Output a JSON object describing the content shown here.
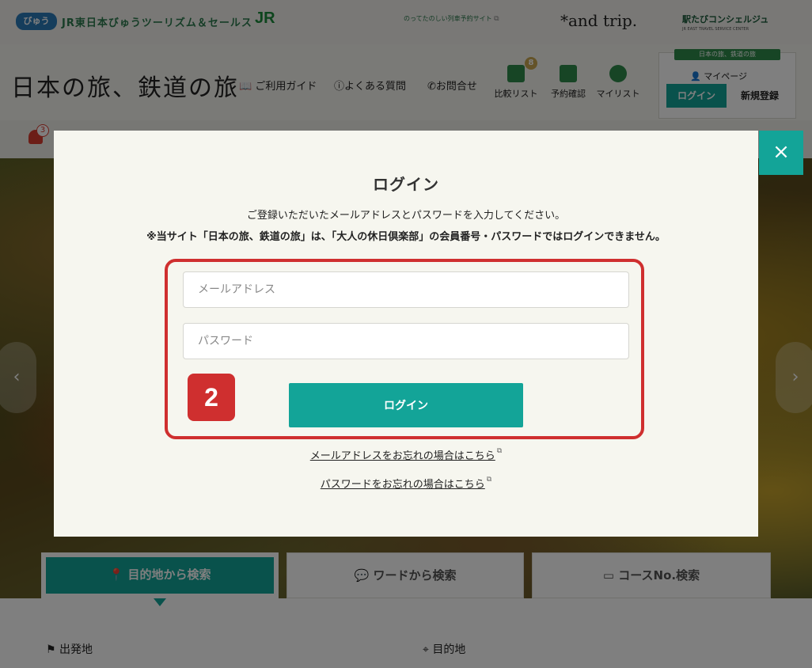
{
  "header": {
    "brand_badge": "びゅう",
    "tour_company": "JR東日本びゅうツーリズム＆セールス",
    "jr_logo": "JR",
    "promo": "のってたのしい列車予約サイト",
    "andtrip": "*and trip.",
    "concierge": "駅たびコンシェルジュ",
    "concierge_sub": "JR EAST TRAVEL SERVICE CENTER",
    "site_logo": "日本の旅、鉄道の旅",
    "nav": {
      "guide": "ご利用ガイド",
      "faq": "よくある質問",
      "contact": "お問合せ",
      "compare": "比較リスト",
      "compare_count": "8",
      "reservation": "予約確認",
      "mylist": "マイリスト"
    },
    "login_panel": {
      "ribbon": "日本の旅、鉄道の旅",
      "mypage": "マイページ",
      "login": "ログイン",
      "register": "新規登録"
    },
    "notification_count": "3"
  },
  "search": {
    "tabs": [
      {
        "label": "目的地から検索"
      },
      {
        "label": "ワードから検索"
      },
      {
        "label": "コースNo.検索"
      }
    ],
    "departure_label": "出発地",
    "destination_label": "目的地"
  },
  "modal": {
    "close_label": "×",
    "title": "ログイン",
    "description": "ご登録いただいたメールアドレスとパスワードを入力してください。",
    "warning": "※当サイト「日本の旅、鉄道の旅」は、「大人の休日倶楽部」の会員番号・パスワードではログインできません。",
    "email_placeholder": "メールアドレス",
    "password_placeholder": "パスワード",
    "login_button": "ログイン",
    "forgot_email": "メールアドレスをお忘れの場合はこちら",
    "forgot_password": "パスワードをお忘れの場合はこちら",
    "step_number": "2"
  },
  "colors": {
    "accent": "#13a498",
    "highlight": "#cf2f2f",
    "brand_green": "#2e8a4a"
  }
}
